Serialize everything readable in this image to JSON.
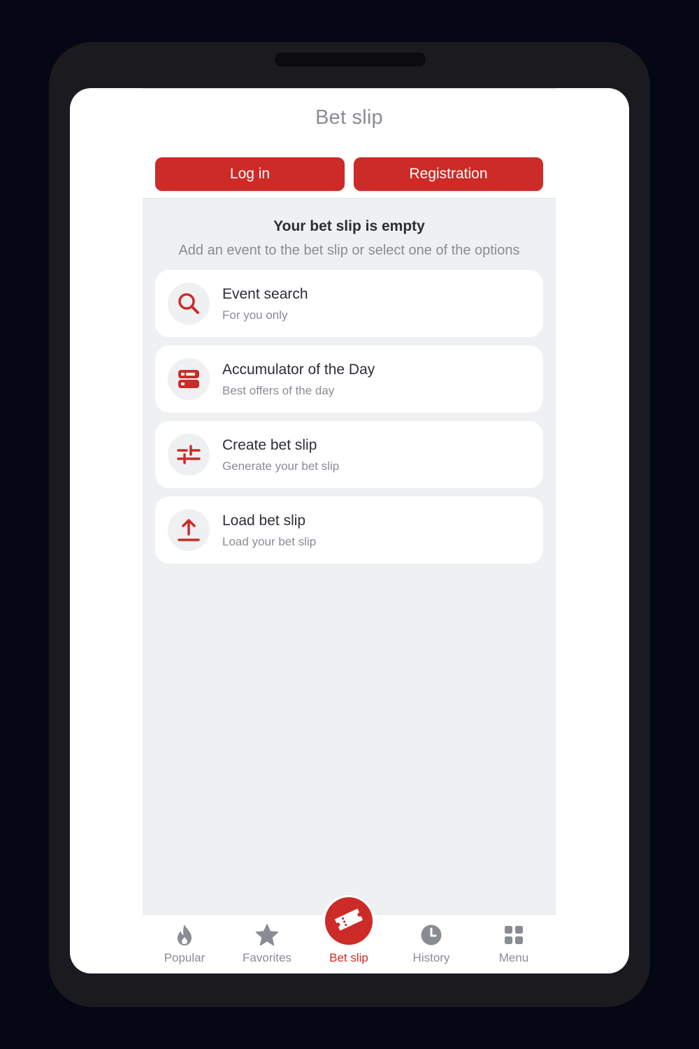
{
  "header": {
    "title": "Bet slip"
  },
  "auth": {
    "login_label": "Log in",
    "register_label": "Registration"
  },
  "empty_state": {
    "title": "Your bet slip is empty",
    "subtitle": "Add an event to the bet slip or select one of the options"
  },
  "options": [
    {
      "title": "Event search",
      "subtitle": "For you only",
      "icon": "search-icon"
    },
    {
      "title": "Accumulator of the Day",
      "subtitle": "Best offers of the day",
      "icon": "accumulator-icon"
    },
    {
      "title": "Create bet slip",
      "subtitle": "Generate your bet slip",
      "icon": "sliders-icon"
    },
    {
      "title": "Load bet slip",
      "subtitle": "Load your bet slip",
      "icon": "upload-icon"
    }
  ],
  "bottom_nav": [
    {
      "label": "Popular",
      "icon": "flame-icon"
    },
    {
      "label": "Favorites",
      "icon": "star-icon"
    },
    {
      "label": "Bet slip",
      "icon": "ticket-icon",
      "active": true
    },
    {
      "label": "History",
      "icon": "clock-icon"
    },
    {
      "label": "Menu",
      "icon": "grid-icon"
    }
  ],
  "colors": {
    "accent": "#cc2b27",
    "background": "#eef0f2",
    "text_primary": "#2b2e35",
    "text_secondary": "#8a8c93"
  }
}
